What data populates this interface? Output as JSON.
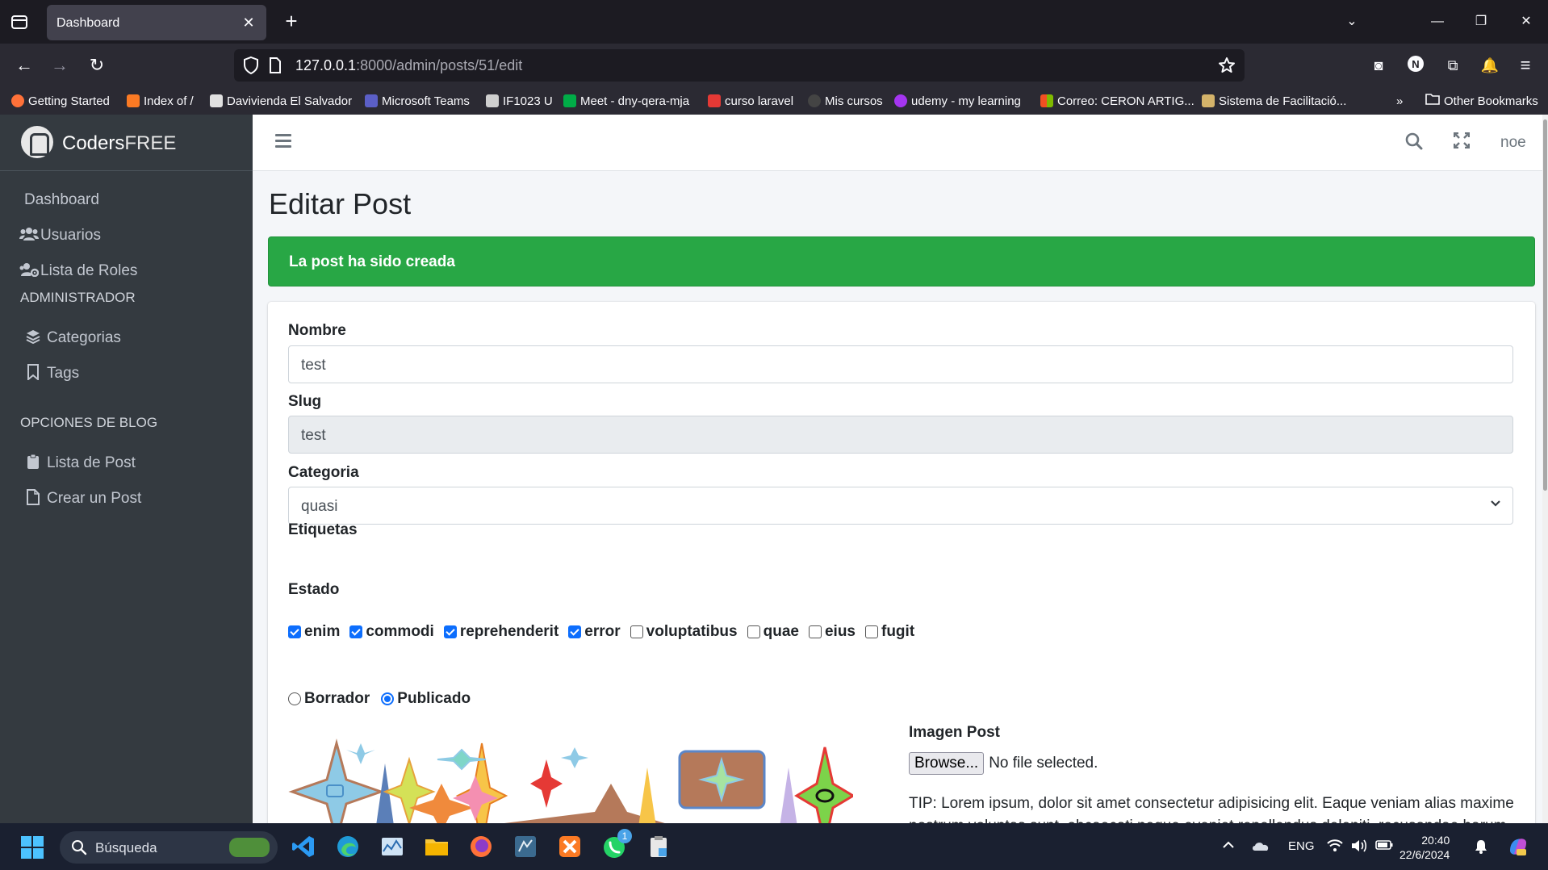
{
  "browser": {
    "tab_title": "Dashboard",
    "url_host": "127.0.0.1",
    "url_path": ":8000/admin/posts/51/edit",
    "bookmarks": [
      {
        "label": "Getting Started",
        "color": "#ff7139"
      },
      {
        "label": "Index of /",
        "color": "#fb7a24"
      },
      {
        "label": "Davivienda El Salvador",
        "color": "#e0e0e0"
      },
      {
        "label": "Microsoft Teams",
        "color": "#5b5fc7"
      },
      {
        "label": "IF1023 U",
        "color": "#cfcfcf"
      },
      {
        "label": "Meet - dny-qera-mja",
        "color": "#00ac47"
      },
      {
        "label": "curso laravel",
        "color": "#e53935"
      },
      {
        "label": "Mis cursos",
        "color": "#444444"
      },
      {
        "label": "udemy - my learning",
        "color": "#a435f0"
      },
      {
        "label": "Correo: CERON ARTIG...",
        "color": "#f25022"
      },
      {
        "label": "Sistema de Facilitació...",
        "color": "#d4b36a"
      }
    ],
    "other_bookmarks": "Other Bookmarks"
  },
  "sidebar": {
    "brand_bold": "Coders",
    "brand_light": "FREE",
    "items": [
      {
        "label": "Dashboard",
        "icon": ""
      },
      {
        "label": "Usuarios",
        "icon": "users-icon"
      },
      {
        "label": "Lista de Roles",
        "icon": "users-cog-icon"
      }
    ],
    "header_admin": "ADMINISTRADOR",
    "admin_items": [
      {
        "label": "Categorias",
        "icon": "layers-icon"
      },
      {
        "label": "Tags",
        "icon": "bookmark-icon"
      }
    ],
    "header_blog": "OPCIONES DE BLOG",
    "blog_items": [
      {
        "label": "Lista de Post",
        "icon": "clipboard-icon"
      },
      {
        "label": "Crear un Post",
        "icon": "file-icon"
      }
    ]
  },
  "topnav": {
    "user": "noe"
  },
  "content": {
    "title": "Editar Post",
    "alert": "La post ha sido creada",
    "nombre_label": "Nombre",
    "nombre_value": "test",
    "slug_label": "Slug",
    "slug_value": "test",
    "categoria_label": "Categoria",
    "categoria_value": "quasi",
    "etiquetas_label": "Etiquetas",
    "tags": [
      {
        "label": "enim",
        "checked": true
      },
      {
        "label": "commodi",
        "checked": true
      },
      {
        "label": "reprehenderit",
        "checked": true
      },
      {
        "label": "error",
        "checked": true
      },
      {
        "label": "voluptatibus",
        "checked": false
      },
      {
        "label": "quae",
        "checked": false
      },
      {
        "label": "eius",
        "checked": false
      },
      {
        "label": "fugit",
        "checked": false
      }
    ],
    "estado_label": "Estado",
    "estado_options": [
      {
        "label": "Borrador",
        "checked": false
      },
      {
        "label": "Publicado",
        "checked": true
      }
    ],
    "imagen_label": "Imagen Post",
    "browse_label": "Browse...",
    "file_status": "No file selected.",
    "tip": "TIP: Lorem ipsum, dolor sit amet consectetur adipisicing elit. Eaque veniam alias maxime nostrum voluptas sunt, obcaecati neque eveniet repellendus deleniti, recusandae harum"
  },
  "taskbar": {
    "search_placeholder": "Búsqueda",
    "lang": "ENG",
    "time": "20:40",
    "date": "22/6/2024",
    "whatsapp_badge": "1"
  }
}
